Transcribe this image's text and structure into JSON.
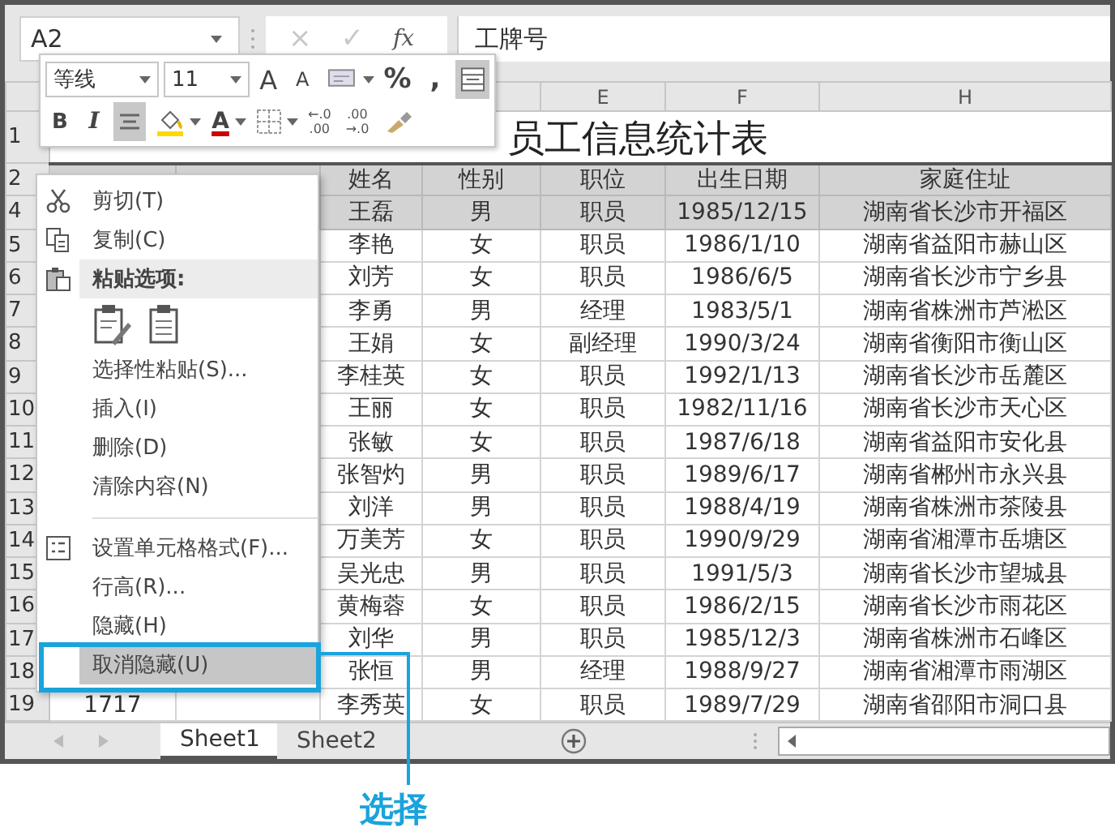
{
  "formula_bar": {
    "name_box": "A2",
    "cancel": "×",
    "enter": "✓",
    "function": "fx",
    "value": "工牌号"
  },
  "mini_toolbar": {
    "rows": [
      [
        {
          "kind": "select",
          "label": "等线"
        },
        {
          "kind": "select",
          "label": "11"
        },
        {
          "kind": "grow",
          "label": "A",
          "selected": false
        },
        {
          "kind": "shrink",
          "label": "A",
          "selected": false
        },
        {
          "kind": "format",
          "selected": false
        },
        {
          "kind": "text",
          "label": "%",
          "selected": false
        },
        {
          "kind": "text",
          "label": ",",
          "selected": false
        },
        {
          "kind": "merge",
          "selected": true
        }
      ],
      [
        {
          "kind": "bold",
          "label": "B",
          "selected": false
        },
        {
          "kind": "italic",
          "label": "I",
          "selected": false
        },
        {
          "kind": "align",
          "selected": true
        },
        {
          "kind": "fill",
          "selected": false
        },
        {
          "kind": "fontcolor",
          "label": "A",
          "selected": false
        },
        {
          "kind": "borders",
          "selected": false
        },
        {
          "kind": "decimal",
          "lines": [
            "←.0",
            ".00"
          ],
          "selected": false
        },
        {
          "kind": "decimal",
          "lines": [
            ".00",
            "→.0"
          ],
          "selected": false
        },
        {
          "kind": "brush",
          "selected": false
        }
      ]
    ]
  },
  "column_headers": [
    {
      "label": "E"
    },
    {
      "label": "F"
    },
    {
      "label": "H"
    }
  ],
  "title_row": {
    "number": "1",
    "title": "员工信息统计表"
  },
  "rows": [
    {
      "number": "2",
      "shaded": true,
      "cells": [
        "姓名",
        "性别",
        "职位",
        "出生日期",
        "家庭住址"
      ]
    },
    {
      "number": "4",
      "shaded": true,
      "cells": [
        "王磊",
        "男",
        "职员",
        "1985/12/15",
        "湖南省长沙市开福区"
      ]
    },
    {
      "number": "5",
      "shaded": false,
      "cells": [
        "李艳",
        "女",
        "职员",
        "1986/1/10",
        "湖南省益阳市赫山区"
      ]
    },
    {
      "number": "6",
      "shaded": false,
      "cells": [
        "刘芳",
        "女",
        "职员",
        "1986/6/5",
        "湖南省长沙市宁乡县"
      ]
    },
    {
      "number": "7",
      "shaded": false,
      "cells": [
        "李勇",
        "男",
        "经理",
        "1983/5/1",
        "湖南省株洲市芦淞区"
      ]
    },
    {
      "number": "8",
      "shaded": false,
      "cells": [
        "王娟",
        "女",
        "副经理",
        "1990/3/24",
        "湖南省衡阳市衡山区"
      ]
    },
    {
      "number": "9",
      "shaded": false,
      "cells": [
        "李桂英",
        "女",
        "职员",
        "1992/1/13",
        "湖南省长沙市岳麓区"
      ]
    },
    {
      "number": "10",
      "shaded": false,
      "cells": [
        "王丽",
        "女",
        "职员",
        "1982/11/16",
        "湖南省长沙市天心区"
      ]
    },
    {
      "number": "11",
      "shaded": false,
      "cells": [
        "张敏",
        "女",
        "职员",
        "1987/6/18",
        "湖南省益阳市安化县"
      ]
    },
    {
      "number": "12",
      "shaded": false,
      "cells": [
        "张智灼",
        "男",
        "职员",
        "1989/6/17",
        "湖南省郴州市永兴县"
      ]
    },
    {
      "number": "13",
      "shaded": false,
      "cells": [
        "刘洋",
        "男",
        "职员",
        "1988/4/19",
        "湖南省株洲市茶陵县"
      ]
    },
    {
      "number": "14",
      "shaded": false,
      "cells": [
        "万美芳",
        "女",
        "职员",
        "1990/9/29",
        "湖南省湘潭市岳塘区"
      ]
    },
    {
      "number": "15",
      "shaded": false,
      "cells": [
        "吴光忠",
        "男",
        "职员",
        "1991/5/3",
        "湖南省长沙市望城县"
      ]
    },
    {
      "number": "16",
      "shaded": false,
      "cells": [
        "黄梅蓉",
        "女",
        "职员",
        "1986/2/15",
        "湖南省长沙市雨花区"
      ]
    },
    {
      "number": "17",
      "shaded": false,
      "cells": [
        "刘华",
        "男",
        "职员",
        "1985/12/3",
        "湖南省株洲市石峰区"
      ]
    },
    {
      "number": "18",
      "shaded": false,
      "cells": [
        "张恒",
        "男",
        "经理",
        "1988/9/27",
        "湖南省湘潭市雨湖区"
      ]
    },
    {
      "number": "19",
      "shaded": false,
      "column_a": "1717",
      "cells": [
        "李秀英",
        "女",
        "职员",
        "1989/7/29",
        "湖南省邵阳市洞口县"
      ]
    }
  ],
  "context_menu": {
    "items": [
      {
        "kind": "command",
        "label": "剪切(T)",
        "selected": false
      },
      {
        "kind": "command",
        "label": "复制(C)",
        "selected": false
      },
      {
        "kind": "header",
        "label": "粘贴选项:"
      },
      {
        "kind": "paste_options"
      },
      {
        "kind": "command",
        "label": "选择性粘贴(S)...",
        "selected": false
      },
      {
        "kind": "command",
        "label": "插入(I)",
        "selected": false
      },
      {
        "kind": "command",
        "label": "删除(D)",
        "selected": false
      },
      {
        "kind": "command",
        "label": "清除内容(N)",
        "selected": false
      },
      {
        "kind": "separator"
      },
      {
        "kind": "command",
        "label": "设置单元格格式(F)...",
        "selected": false
      },
      {
        "kind": "command",
        "label": "行高(R)...",
        "selected": false
      },
      {
        "kind": "command",
        "label": "隐藏(H)",
        "selected": false
      },
      {
        "kind": "command",
        "label": "取消隐藏(U)",
        "selected": true
      }
    ]
  },
  "sheet_tabs": [
    {
      "label": "Sheet1",
      "selected": true
    },
    {
      "label": "Sheet2",
      "selected": false
    }
  ],
  "annotation": {
    "label": "选择"
  }
}
